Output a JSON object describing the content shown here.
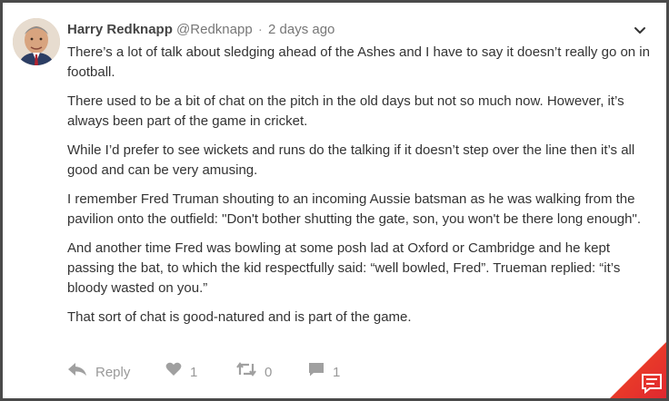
{
  "comment": {
    "author": "Harry Redknapp",
    "handle": "@Redknapp",
    "separator": "·",
    "time": "2 days ago",
    "paragraphs": [
      "There’s a lot of talk about sledging ahead of the Ashes and I have to say it doesn’t really go on in football.",
      "There used to be a bit of chat on the pitch in the old days but not so much now. However, it’s always been part of the game in cricket.",
      "While I’d prefer to see wickets and runs do the talking if it doesn’t step over the line then it’s all good and can be very amusing.",
      "I remember Fred Truman shouting to an incoming Aussie batsman as he was walking from the pavilion onto the outfield: \"Don't bother shutting the gate, son, you won't be there long enough\".",
      "And another time Fred was bowling at some posh lad at Oxford or Cambridge and he kept passing the bat, to which the kid respectfully said: “well bowled, Fred”. Trueman replied: “it’s bloody wasted on you.”",
      "That sort of chat is good-natured and is part of the game."
    ]
  },
  "actions": {
    "reply_label": "Reply",
    "likes": "1",
    "reposts": "0",
    "comments": "1"
  },
  "icons": {
    "menu": "chevron-down-icon",
    "reply": "reply-arrow-icon",
    "like": "heart-icon",
    "repost": "repost-icon",
    "comment": "speech-bubble-icon",
    "corner": "chat-icon"
  },
  "colors": {
    "corner_top": "#f04b22",
    "corner_bottom": "#e02830",
    "icon_gray": "#a0a0a0"
  }
}
